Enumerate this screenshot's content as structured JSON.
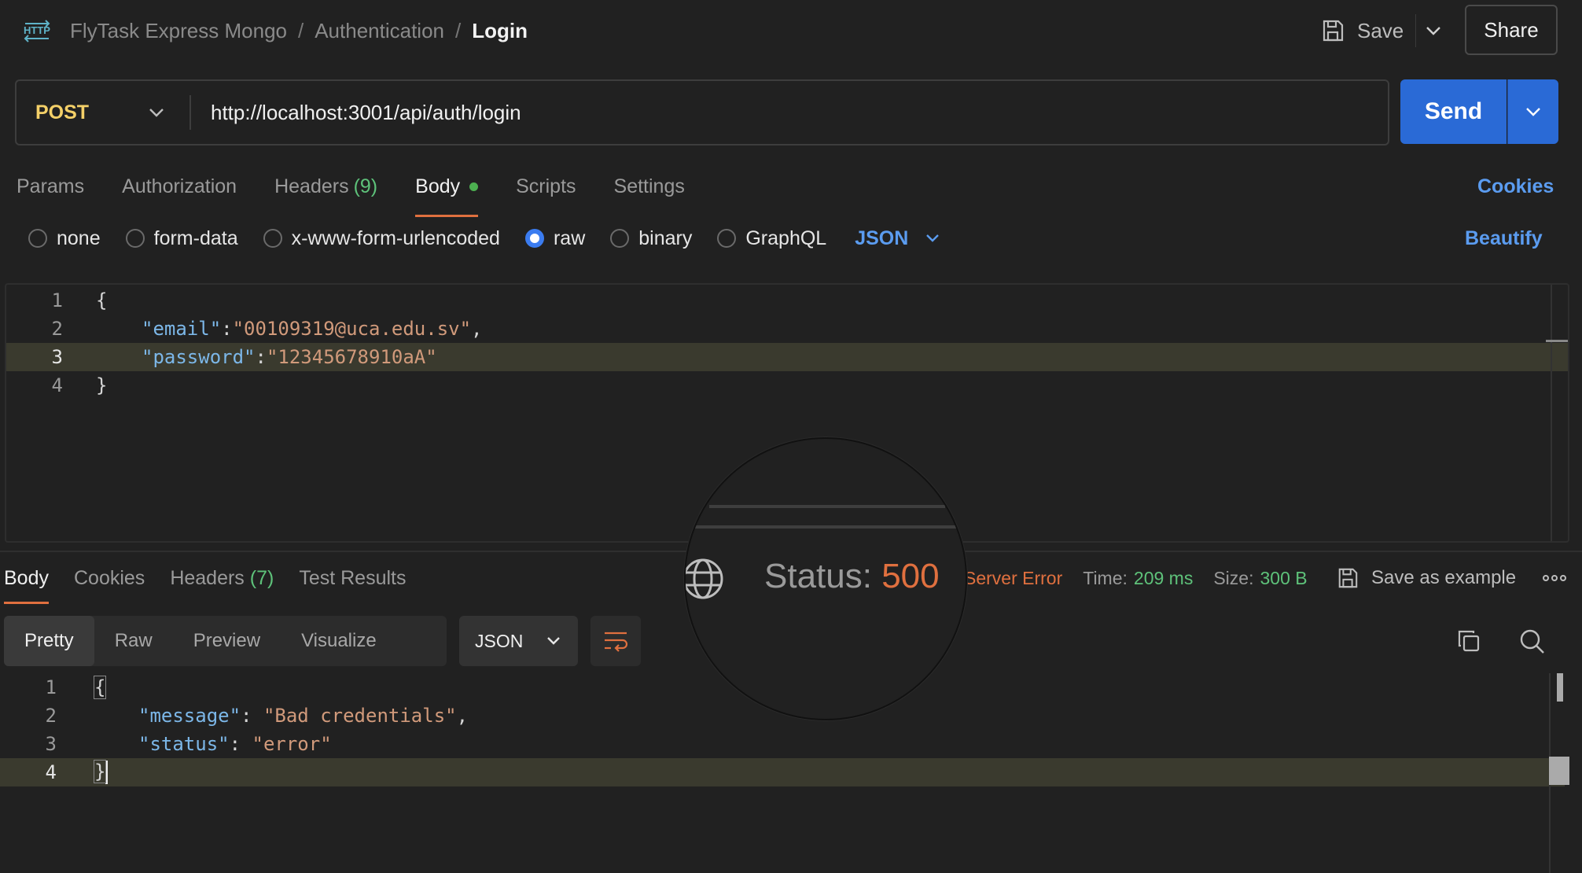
{
  "header": {
    "breadcrumb": [
      "FlyTask Express Mongo",
      "Authentication",
      "Login"
    ],
    "separator": "/",
    "save_label": "Save",
    "share_label": "Share"
  },
  "request": {
    "method": "POST",
    "url": "http://localhost:3001/api/auth/login",
    "send_label": "Send",
    "method_color": "#f4d068"
  },
  "request_tabs": {
    "params": "Params",
    "authorization": "Authorization",
    "headers": "Headers",
    "headers_count": "(9)",
    "body": "Body",
    "scripts": "Scripts",
    "settings": "Settings",
    "cookies": "Cookies",
    "active": "Body"
  },
  "body_options": {
    "none": "none",
    "form_data": "form-data",
    "urlencoded": "x-www-form-urlencoded",
    "raw": "raw",
    "binary": "binary",
    "graphql": "GraphQL",
    "selected": "raw",
    "language": "JSON",
    "beautify": "Beautify"
  },
  "request_body": {
    "line_numbers": [
      "1",
      "2",
      "3",
      "4"
    ],
    "open_brace": "{",
    "close_brace": "}",
    "email_key": "\"email\"",
    "email_value": "\"00109319@uca.edu.sv\"",
    "password_key": "\"password\"",
    "password_value": "\"12345678910aA\"",
    "colon": ":",
    "comma": ","
  },
  "response_tabs": {
    "body": "Body",
    "cookies": "Cookies",
    "headers": "Headers",
    "headers_count": "(7)",
    "test_results": "Test Results",
    "active": "Body"
  },
  "response_meta": {
    "status_label": "Status:",
    "status_code": "500",
    "status_text": "Server Error",
    "time_label": "Time:",
    "time_value": "209 ms",
    "size_label": "Size:",
    "size_value": "300 B",
    "save_example": "Save as example"
  },
  "response_toolbar": {
    "pretty": "Pretty",
    "raw": "Raw",
    "preview": "Preview",
    "visualize": "Visualize",
    "format": "JSON",
    "active": "Pretty"
  },
  "response_body": {
    "line_numbers": [
      "1",
      "2",
      "3",
      "4"
    ],
    "open_brace": "{",
    "close_brace": "}",
    "message_key": "\"message\"",
    "message_value": "\"Bad credentials\"",
    "status_key": "\"status\"",
    "status_value": "\"error\"",
    "colon": ": ",
    "comma": ","
  },
  "colors": {
    "accent_blue": "#2a6ad6",
    "link_blue": "#5b9cf0",
    "tab_underline": "#e0703f",
    "error": "#e0703f",
    "success_green": "#5ec27a"
  }
}
